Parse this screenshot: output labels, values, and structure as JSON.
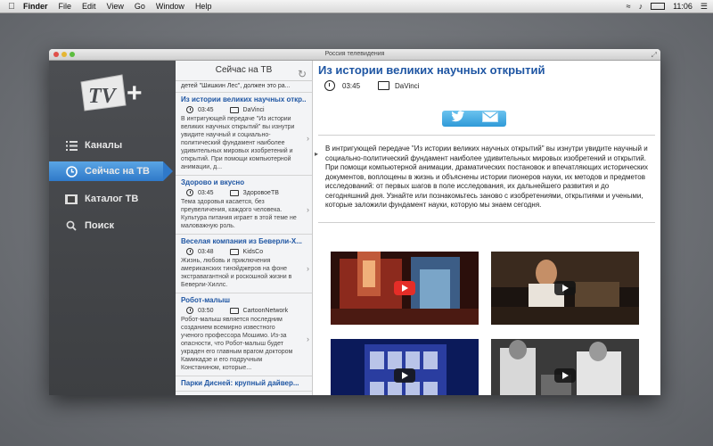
{
  "menubar": {
    "apple": "",
    "items": [
      "Finder",
      "File",
      "Edit",
      "View",
      "Go",
      "Window",
      "Help"
    ],
    "time": "11:06"
  },
  "window": {
    "title": "Россия телевидения"
  },
  "sidebar": {
    "logo_text": "TV",
    "logo_plus": "+",
    "items": [
      {
        "label": "Каналы",
        "icon": "list-icon"
      },
      {
        "label": "Сейчас на ТВ",
        "icon": "clock-icon",
        "active": true
      },
      {
        "label": "Каталог ТВ",
        "icon": "film-icon"
      },
      {
        "label": "Поиск",
        "icon": "search-icon"
      }
    ]
  },
  "feed": {
    "header": "Сейчас на ТВ",
    "top_fragment": "детей \"Шишкин Лес\", должен это ра...",
    "items": [
      {
        "title": "Из истории великих научных откр...",
        "time": "03:45",
        "channel": "DaVinci",
        "desc": "В интригующей передаче \"Из истории великих научных открытий\" вы изнутри увидите научный и социально-политический фундамент наиболее удивительных мировых изобретений и открытий. При помощи компьютерной анимации, д..."
      },
      {
        "title": "Здорово и вкусно",
        "time": "03:45",
        "channel": "ЗдоровоеТВ",
        "desc": "Тема здоровья касается, без преувеличения, каждого человека. Культура питания играет в этой теме не маловажную роль."
      },
      {
        "title": "Веселая компания из Беверли-Х...",
        "time": "03:48",
        "channel": "KidsCo",
        "desc": "Жизнь, любовь и приключения американских тинэйджеров на фоне экстравагантной и роскошной жизни в Беверли-Хиллс."
      },
      {
        "title": "Робот-малыш",
        "time": "03:50",
        "channel": "CartoonNetwork",
        "desc": "Робот-малыш является последним созданием всемирно известного ученого профессора Мошимо. Из-за опасности, что Робот-малыш будет украден его главным врагом доктором Камикадзе и его подручным Констанином, которые..."
      },
      {
        "title": "Парки Дисней: крупный дайвер...",
        "time": "",
        "channel": "",
        "desc": ""
      }
    ]
  },
  "main": {
    "title": "Из истории великих научных открытий",
    "time": "03:45",
    "channel": "DaVinci",
    "share": {
      "twitter_icon": "twitter-icon",
      "mail_icon": "mail-icon"
    },
    "description": "В интригующей передаче \"Из истории великих научных открытий\" вы изнутри увидите научный и социально-политический фундамент наиболее удивительных мировых изобретений и открытий. При помощи компьютерной анимации, драматических постановок и впечатляющих исторических документов, воплощены в жизнь и объяснены истории пионеров науки, их методов и предметов исследований: от первых шагов в поле исследования, их дальнейшего развития и до сегодняшний дня. Узнайте или познакомьтесь заново с изобретениями, открытиями и учеными, которые заложили фундамент науки, которую мы знаем сегодня.",
    "videos": [
      {
        "name": "video-1",
        "play": "youtube"
      },
      {
        "name": "video-2",
        "play": "dark"
      },
      {
        "name": "video-3",
        "play": "dark"
      },
      {
        "name": "video-4",
        "play": "dark"
      }
    ]
  },
  "colors": {
    "accent": "#2f79c9",
    "link": "#1f56a3",
    "sidebar_bg": "#434548"
  }
}
